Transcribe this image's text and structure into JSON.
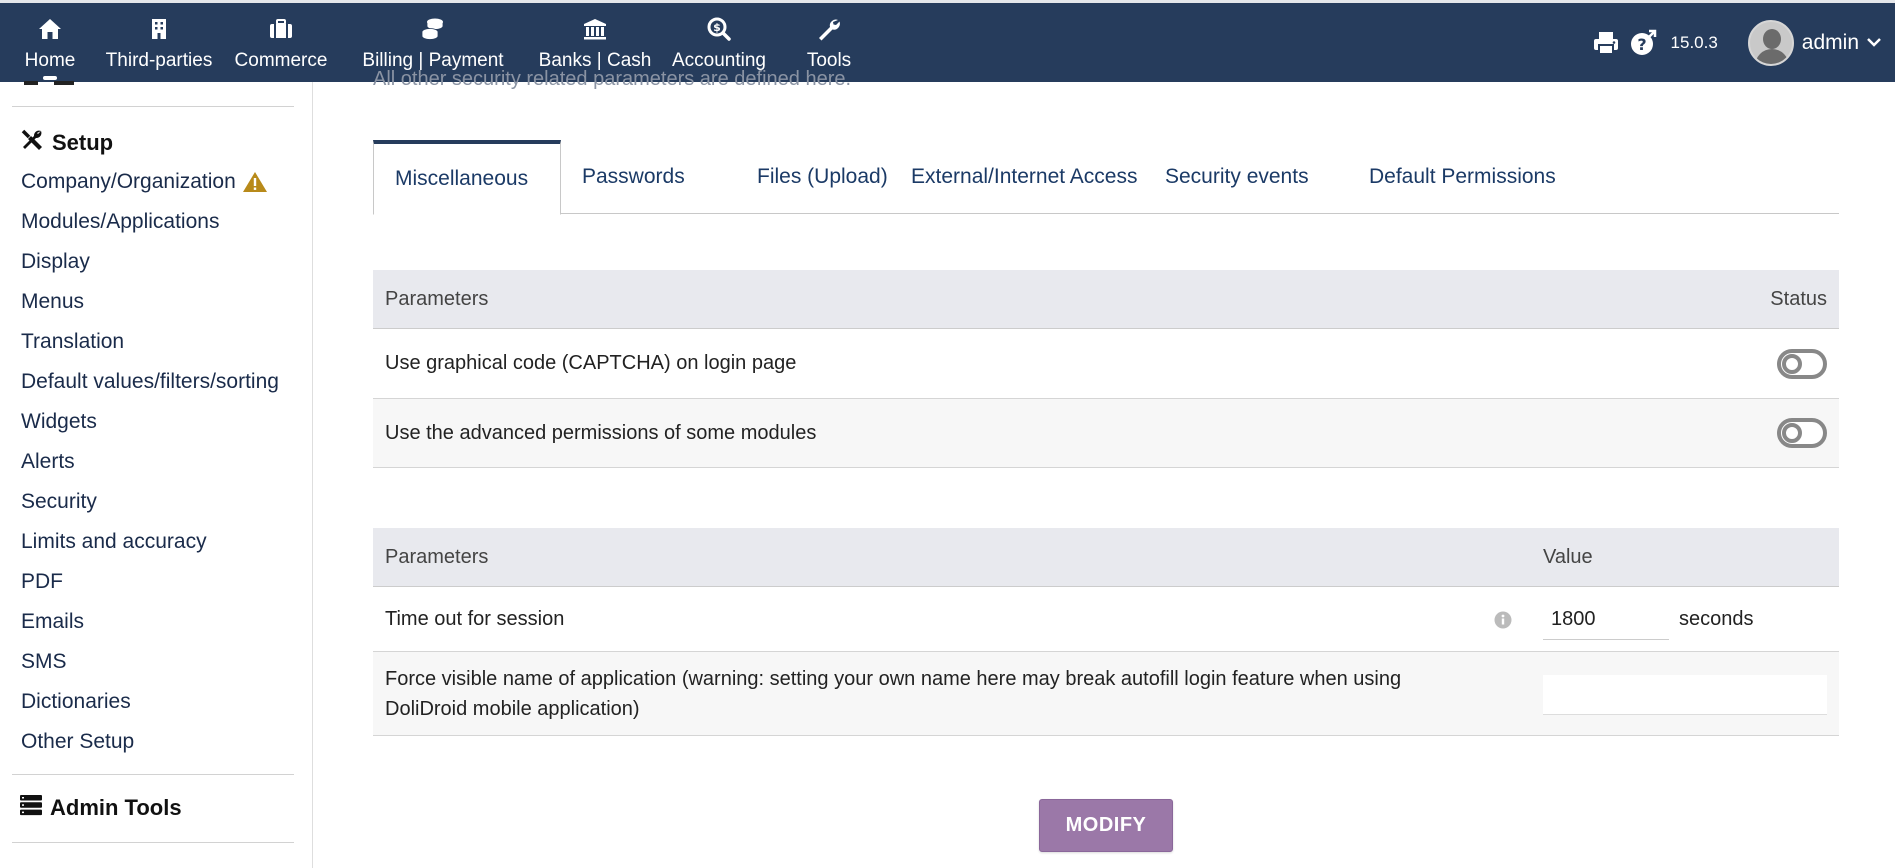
{
  "topnav": {
    "items": [
      {
        "label": "Home",
        "icon": "home-icon"
      },
      {
        "label": "Third-parties",
        "icon": "building-icon"
      },
      {
        "label": "Commerce",
        "icon": "briefcase-icon"
      },
      {
        "label": "Billing | Payment",
        "icon": "coins-icon"
      },
      {
        "label": "Banks | Cash",
        "icon": "bank-icon"
      },
      {
        "label": "Accounting",
        "icon": "search-dollar-icon"
      },
      {
        "label": "Tools",
        "icon": "wrench-icon"
      }
    ],
    "version": "15.0.3",
    "username": "admin"
  },
  "sidebar": {
    "section_setup": "Setup",
    "items": [
      "Company/Organization",
      "Modules/Applications",
      "Display",
      "Menus",
      "Translation",
      "Default values/filters/sorting",
      "Widgets",
      "Alerts",
      "Security",
      "Limits and accuracy",
      "PDF",
      "Emails",
      "SMS",
      "Dictionaries",
      "Other Setup"
    ],
    "section_admin": "Admin Tools"
  },
  "main": {
    "cut_text": "All other security related parameters are defined here.",
    "tabs": [
      "Miscellaneous",
      "Passwords",
      "Files (Upload)",
      "External/Internet Access",
      "Security events",
      "Default Permissions"
    ],
    "status_table": {
      "col_params": "Parameters",
      "col_status": "Status",
      "rows": [
        {
          "label": "Use graphical code (CAPTCHA) on login page",
          "enabled": false
        },
        {
          "label": "Use the advanced permissions of some modules",
          "enabled": false
        }
      ]
    },
    "value_table": {
      "col_params": "Parameters",
      "col_value": "Value",
      "session_label": "Time out for session",
      "session_value": "1800",
      "session_unit": "seconds",
      "appname_label": "Force visible name of application (warning: setting your own name here may break autofill login feature when using DoliDroid mobile application)",
      "appname_value": ""
    },
    "modify_button": "MODIFY"
  },
  "colors": {
    "topbar": "#263c5c",
    "button": "#9b78a8",
    "warning": "#b88a1a"
  }
}
